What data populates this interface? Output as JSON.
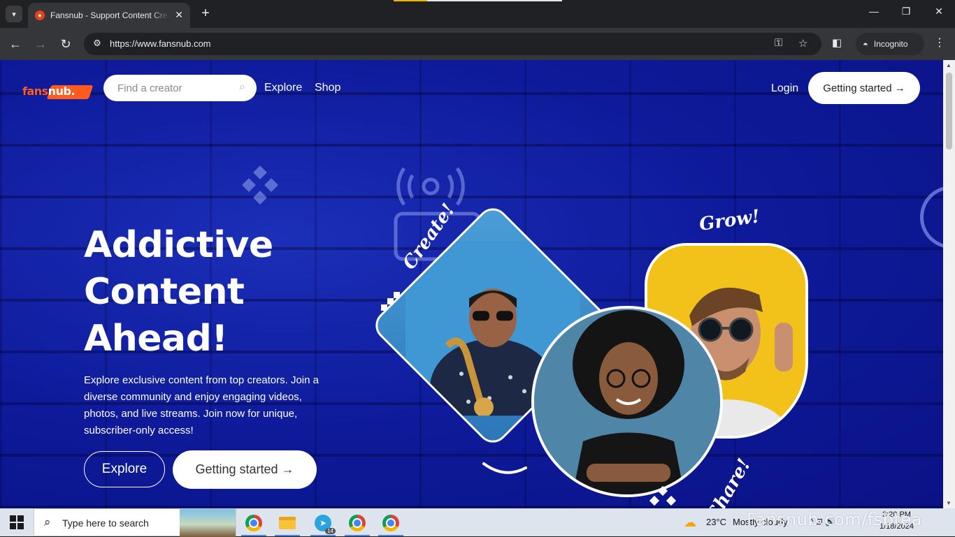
{
  "browser": {
    "tab_title": "Fansnub - Support Content Creators",
    "tab_favicon": "fansnub-favicon",
    "url": "https://www.fansnub.com",
    "incognito_label": "Incognito"
  },
  "page": {
    "logo": {
      "part1": "fans",
      "part2": "nub."
    },
    "search": {
      "placeholder": "Find a creator"
    },
    "nav": {
      "explore": "Explore",
      "shop": "Shop"
    },
    "login": "Login",
    "getting_started_top": "Getting started →",
    "hero": {
      "title_line1": "Addictive",
      "title_line2": "Content",
      "title_line3": "Ahead!",
      "description": "Explore exclusive content from top creators. Join a diverse community and enjoy engaging videos, photos, and live streams. Join now for unique, subscriber-only access!",
      "explore_button": "Explore",
      "start_button": "Getting started →"
    },
    "art_words": {
      "create": "Create!",
      "grow": "Grow!",
      "share": "Share!"
    }
  },
  "taskbar": {
    "search_placeholder": "Type here to search",
    "telegram_badge": "14",
    "weather_temp": "23°C",
    "weather_desc": "Mostly cloudy",
    "time": "3:20 PM",
    "date": "1/18/2024",
    "watermark": "Fansnub.com/fsbtea"
  },
  "colors": {
    "brand_orange": "#ff5a1f",
    "hero_blue": "#0e1a9a"
  }
}
